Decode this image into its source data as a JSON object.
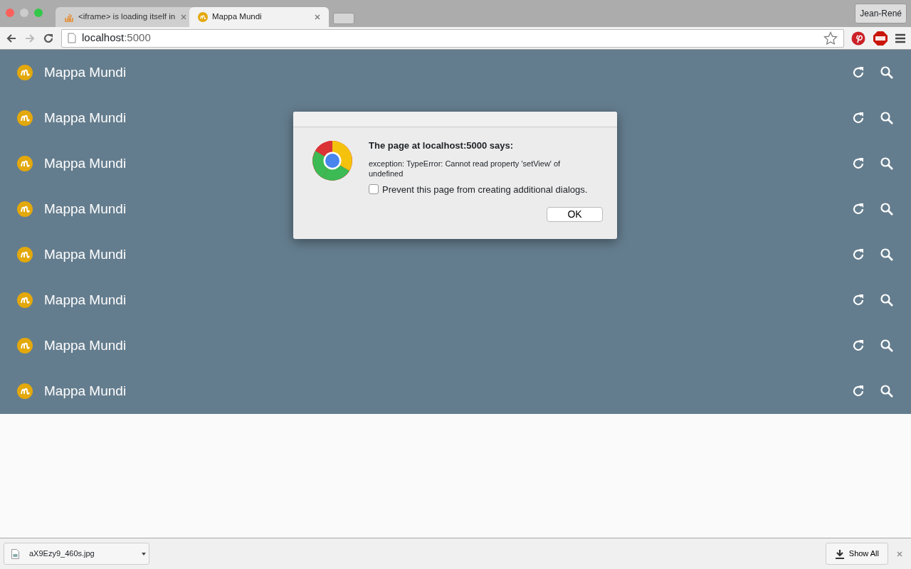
{
  "tabs": [
    {
      "title": "<iframe> is loading itself in",
      "kind": "stack",
      "selected": false
    },
    {
      "title": "Mappa Mundi",
      "kind": "mappa",
      "selected": true
    }
  ],
  "profile": {
    "label": "Jean-René"
  },
  "address_bar": {
    "host": "localhost",
    "port": ":5000"
  },
  "app_bars": [
    {
      "title": "Mappa Mundi"
    },
    {
      "title": "Mappa Mundi"
    },
    {
      "title": "Mappa Mundi"
    },
    {
      "title": "Mappa Mundi"
    },
    {
      "title": "Mappa Mundi"
    },
    {
      "title": "Mappa Mundi"
    },
    {
      "title": "Mappa Mundi"
    },
    {
      "title": "Mappa Mundi"
    }
  ],
  "dialog": {
    "title": "The page at localhost:5000 says:",
    "message": "exception: TypeError: Cannot read property 'setView' of undefined",
    "checkbox": {
      "label": "Prevent this page from creating additional dialogs.",
      "checked": false
    },
    "button": "OK"
  },
  "download_bar": {
    "file": "aX9Ezy9_460s.jpg",
    "show_all": "Show All"
  }
}
